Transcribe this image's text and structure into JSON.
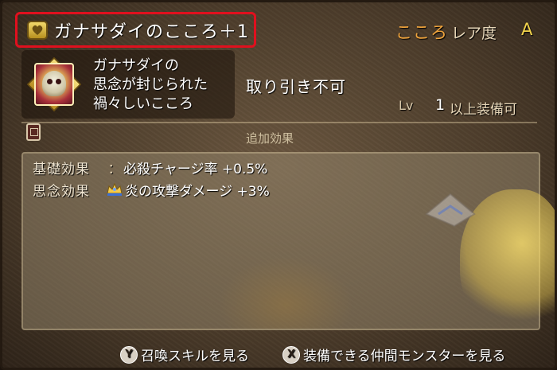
{
  "title": {
    "icon": "heart-icon",
    "text": "ガナサダイのこころ＋1"
  },
  "header": {
    "kokoro": "こころ",
    "rarity_label": "レア度",
    "rarity_value": "A"
  },
  "item": {
    "portrait_icon": "skull-portrait-icon",
    "name_line1": "ガナサダイの",
    "name_line2": "思念が封じられた",
    "name_line3": "禍々しいこころ",
    "trade_status": "取り引き不可",
    "lv_label": "Lv",
    "lv_value": "1",
    "equip_text": "以上装備可"
  },
  "effects": {
    "header": "追加効果",
    "rows": [
      {
        "name": "基礎効果",
        "sep": "：",
        "value": "必殺チャージ率 +0.5%"
      },
      {
        "name": "思念効果",
        "sep": "",
        "icon": "crown-icon",
        "value": "炎の攻撃ダメージ +3%"
      }
    ]
  },
  "footer": {
    "y_button": "Y",
    "y_text": "召喚スキルを見る",
    "x_button": "X",
    "x_text": "装備できる仲間モンスターを見る"
  },
  "colors": {
    "highlight_border": "#e0101e",
    "kokoro_orange": "#f0a43c",
    "rarity_gold": "#f2d34b"
  }
}
